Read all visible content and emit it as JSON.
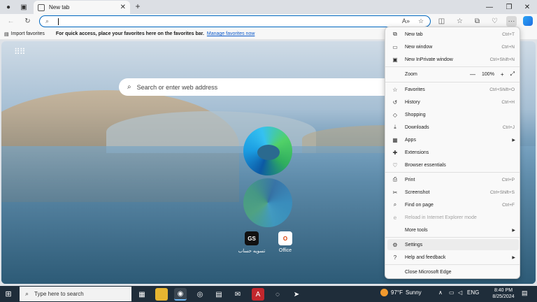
{
  "tab": {
    "title": "New tab",
    "close": "✕",
    "new": "+"
  },
  "window": {
    "minimize": "—",
    "maximize": "❐",
    "close": "✕"
  },
  "address": {
    "value": ""
  },
  "favbar": {
    "import": "Import favorites",
    "message": "For quick access, place your favorites here on the favorites bar.",
    "link": "Manage favorites now"
  },
  "page": {
    "search_placeholder": "Search or enter web address",
    "tiles": [
      {
        "label": "تسویه حساب",
        "icon": "GS"
      },
      {
        "label": "Office",
        "icon": "O"
      }
    ]
  },
  "menu": {
    "items": [
      {
        "label": "New tab",
        "shortcut": "Ctrl+T",
        "icon": "new-tab-icon",
        "glyph": "⧉"
      },
      {
        "label": "New window",
        "shortcut": "Ctrl+N",
        "icon": "new-window-icon",
        "glyph": "▭"
      },
      {
        "label": "New InPrivate window",
        "shortcut": "Ctrl+Shift+N",
        "icon": "inprivate-icon",
        "glyph": "▣"
      },
      {
        "label": "Zoom",
        "shortcut": "",
        "icon": "zoom",
        "glyph": ""
      },
      {
        "label": "Favorites",
        "shortcut": "Ctrl+Shift+O",
        "icon": "favorites-icon",
        "glyph": "☆"
      },
      {
        "label": "History",
        "shortcut": "Ctrl+H",
        "icon": "history-icon",
        "glyph": "↺"
      },
      {
        "label": "Shopping",
        "shortcut": "",
        "icon": "shopping-icon",
        "glyph": "◇"
      },
      {
        "label": "Downloads",
        "shortcut": "Ctrl+J",
        "icon": "downloads-icon",
        "glyph": "⤓"
      },
      {
        "label": "Apps",
        "shortcut": "",
        "icon": "apps-icon",
        "glyph": "▦"
      },
      {
        "label": "Extensions",
        "shortcut": "",
        "icon": "extensions-icon",
        "glyph": "✚"
      },
      {
        "label": "Browser essentials",
        "shortcut": "",
        "icon": "essentials-icon",
        "glyph": "♡"
      },
      {
        "label": "Print",
        "shortcut": "Ctrl+P",
        "icon": "print-icon",
        "glyph": "⎙"
      },
      {
        "label": "Screenshot",
        "shortcut": "Ctrl+Shift+S",
        "icon": "screenshot-icon",
        "glyph": "✂"
      },
      {
        "label": "Find on page",
        "shortcut": "Ctrl+F",
        "icon": "find-icon",
        "glyph": "⌕"
      },
      {
        "label": "Reload in Internet Explorer mode",
        "shortcut": "",
        "icon": "ie-mode-icon",
        "glyph": "e"
      },
      {
        "label": "More tools",
        "shortcut": "",
        "icon": "more-tools-icon",
        "glyph": ""
      },
      {
        "label": "Settings",
        "shortcut": "",
        "icon": "settings-icon",
        "glyph": "⚙"
      },
      {
        "label": "Help and feedback",
        "shortcut": "",
        "icon": "help-icon",
        "glyph": "?"
      },
      {
        "label": "Close Microsoft Edge",
        "shortcut": "",
        "icon": "close-edge-icon",
        "glyph": ""
      }
    ],
    "zoom_value": "100%",
    "zoom_minus": "—",
    "zoom_plus": "+",
    "zoom_fullscreen": "⤢"
  },
  "taskbar": {
    "search": "Type here to search",
    "weather_temp": "97°F",
    "weather_desc": "Sunny",
    "lang": "ENG",
    "time": "8:40 PM",
    "date": "8/25/2024"
  }
}
